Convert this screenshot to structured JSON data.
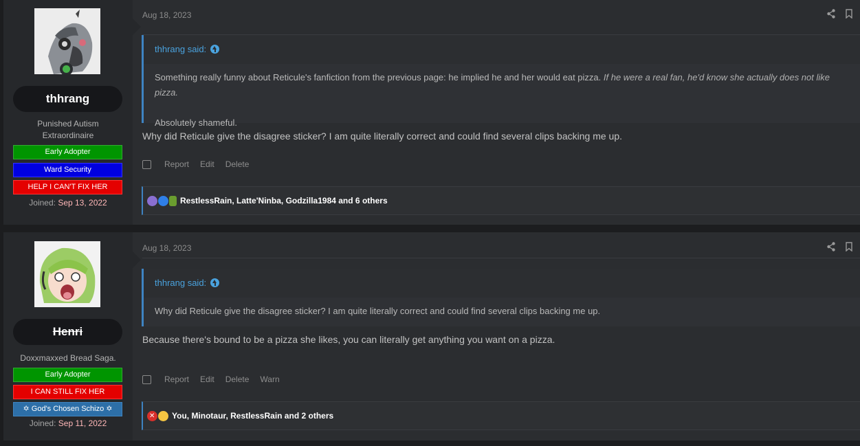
{
  "posts": [
    {
      "author": {
        "username": "thhrang",
        "title_line1": "Punished Autism",
        "title_line2": "Extraordinaire",
        "banners": [
          "Early Adopter",
          "Ward Security",
          "HELP I CAN'T FIX HER"
        ],
        "joined_label": "Joined:",
        "joined_date": "Sep 13, 2022"
      },
      "date": "Aug 18, 2023",
      "quote": {
        "author_said": "thhrang said:",
        "line1_plain": "Something really funny about Reticule's fanfiction from the previous page: he implied he and her would eat pizza. ",
        "line1_italic": "If he were a real fan, he'd know she actually does not like pizza.",
        "line2": "Absolutely shameful."
      },
      "message": "Why did Reticule give the disagree sticker? I am quite literally correct and could find several clips backing me up.",
      "actions": [
        "Report",
        "Edit",
        "Delete"
      ],
      "reactions_text": "RestlessRain, Latte'Ninba, Godzilla1984 and 6 others"
    },
    {
      "author": {
        "username": "Henri",
        "title_line1": "Doxxmaxxed Bread Saga.",
        "banners": [
          "Early Adopter",
          "I CAN STILL FIX HER",
          "✡ God's Chosen Schizo ✡"
        ],
        "joined_label": "Joined:",
        "joined_date": "Sep 11, 2022"
      },
      "date": "Aug 18, 2023",
      "quote": {
        "author_said": "thhrang said:",
        "line1_plain": "Why did Reticule give the disagree sticker? I am quite literally correct and could find several clips backing me up."
      },
      "message": "Because there's bound to be a pizza she likes, you can literally get anything you want on a pizza.",
      "actions": [
        "Report",
        "Edit",
        "Delete",
        "Warn"
      ],
      "reactions_text": "You, Minotaur, RestlessRain and 2 others"
    }
  ],
  "colors": {
    "accent": "#3e83c2",
    "link": "#4aa3df",
    "online": "#46b14a"
  }
}
